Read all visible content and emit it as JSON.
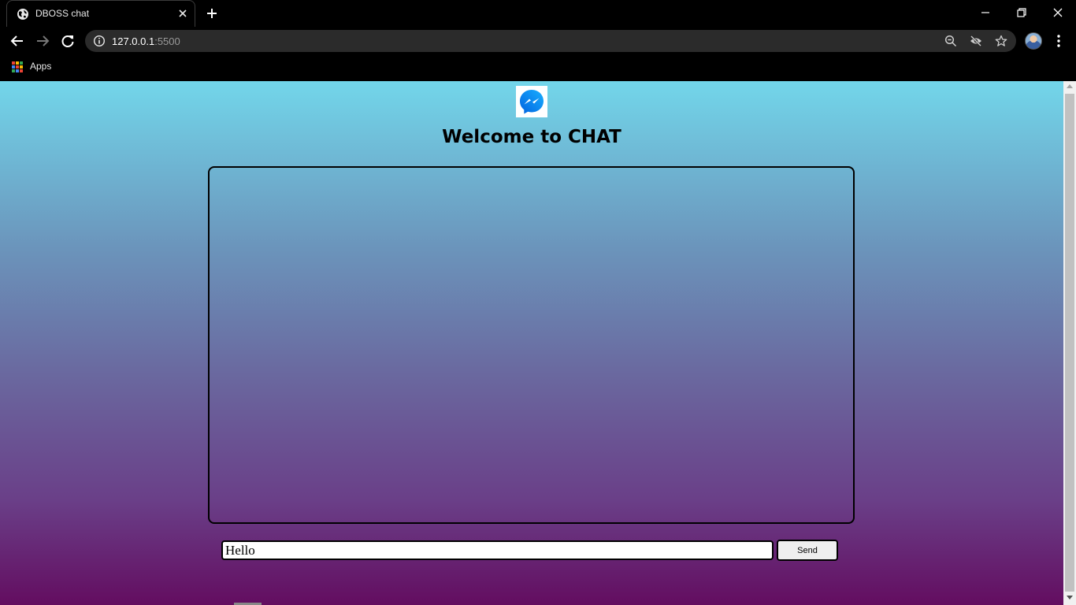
{
  "browser": {
    "tab_title": "DBOSS chat",
    "url_host": "127.0.0.1",
    "url_port": ":5500",
    "bookmarks": {
      "apps_label": "Apps"
    },
    "icons": [
      "globe-icon",
      "close-icon",
      "plus-icon",
      "minimize-icon",
      "restore-icon",
      "back-arrow-icon",
      "forward-arrow-icon",
      "reload-icon",
      "info-icon",
      "zoom-out-icon",
      "tracking-eye-off-icon",
      "star-icon",
      "avatar",
      "kebab-menu-icon",
      "apps-grid-icon"
    ]
  },
  "page": {
    "heading": "Welcome to CHAT",
    "logo": "messenger-logo",
    "message_input_value": "Hello",
    "send_label": "Send",
    "colors": {
      "gradient_top": "#72d6ea",
      "gradient_bottom": "#630d60",
      "messenger_blue": "#0a7cff"
    }
  }
}
